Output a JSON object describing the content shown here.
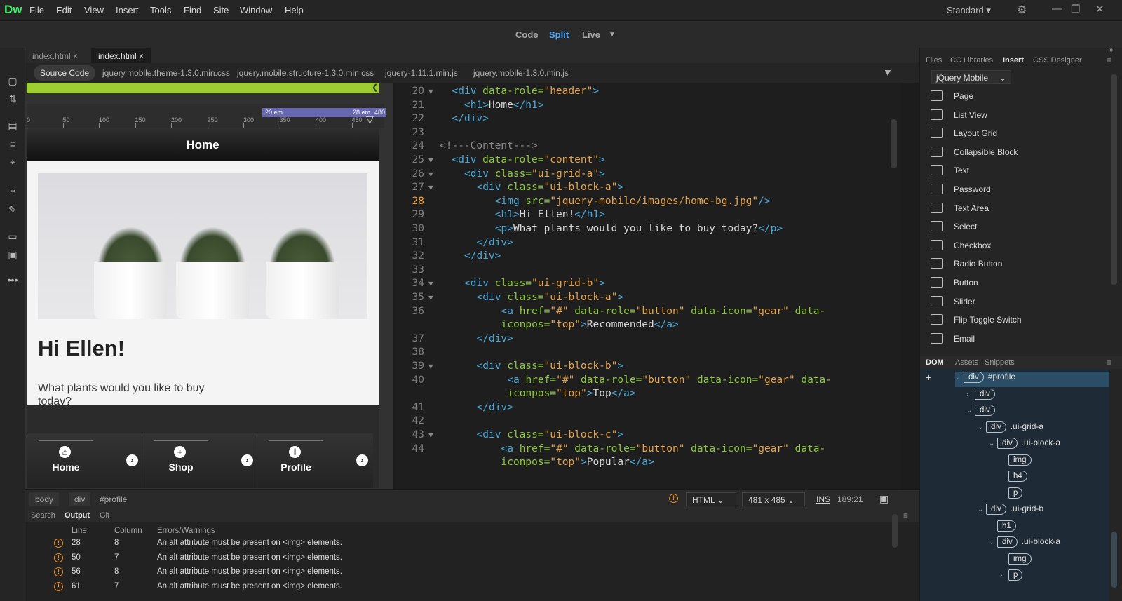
{
  "app": {
    "logo": "Dw",
    "workspace": "Standard ▾"
  },
  "menu": [
    "File",
    "Edit",
    "View",
    "Insert",
    "Tools",
    "Find",
    "Site",
    "Window",
    "Help"
  ],
  "view_modes": {
    "code": "Code",
    "split": "Split",
    "live": "Live",
    "active": "Split"
  },
  "doc_tabs": [
    {
      "label": "index.html ×",
      "active": false
    },
    {
      "label": "index.html ×",
      "active": true
    }
  ],
  "related_files": {
    "source": "Source Code",
    "files": [
      "jquery.mobile.theme-1.3.0.min.css",
      "jquery.mobile.structure-1.3.0.min.css",
      "jquery-1.11.1.min.js",
      "jquery.mobile-1.3.0.min.js"
    ]
  },
  "ruler": {
    "ticks": [
      "0",
      "50",
      "100",
      "150",
      "200",
      "250",
      "300",
      "350",
      "400",
      "450"
    ],
    "bp1": "20 em",
    "bp2": "28 em",
    "bp3": "480"
  },
  "preview": {
    "header": "Home",
    "heading": "Hi Ellen!",
    "text": "What plants would you like to buy today?",
    "nav": [
      {
        "icon": "home-icon",
        "label": "Home"
      },
      {
        "icon": "plus-icon",
        "label": "Shop"
      },
      {
        "icon": "info-icon",
        "label": "Profile"
      }
    ]
  },
  "code": {
    "current_line": "28",
    "lines": [
      {
        "n": "20",
        "fold": true,
        "i": 1,
        "t": [
          [
            "tg",
            "<div "
          ],
          [
            "at",
            "data-role="
          ],
          [
            "va",
            "\"header\""
          ],
          [
            "tg",
            ">"
          ]
        ]
      },
      {
        "n": "21",
        "fold": false,
        "i": 2,
        "t": [
          [
            "tg",
            "<h1>"
          ],
          [
            "tx",
            "Home"
          ],
          [
            "tg",
            "</h1>"
          ]
        ]
      },
      {
        "n": "22",
        "fold": false,
        "i": 1,
        "t": [
          [
            "tg",
            "</div>"
          ]
        ]
      },
      {
        "n": "23",
        "fold": false,
        "i": 0,
        "t": []
      },
      {
        "n": "24",
        "fold": false,
        "i": 0,
        "t": [
          [
            "cm",
            "<!---Content--->"
          ]
        ]
      },
      {
        "n": "25",
        "fold": true,
        "i": 1,
        "t": [
          [
            "tg",
            "<div "
          ],
          [
            "at",
            "data-role="
          ],
          [
            "va",
            "\"content\""
          ],
          [
            "tg",
            ">"
          ]
        ]
      },
      {
        "n": "26",
        "fold": true,
        "i": 2,
        "t": [
          [
            "tg",
            "<div "
          ],
          [
            "at",
            "class="
          ],
          [
            "va",
            "\"ui-grid-a\""
          ],
          [
            "tg",
            ">"
          ]
        ]
      },
      {
        "n": "27",
        "fold": true,
        "i": 3,
        "t": [
          [
            "tg",
            "<div "
          ],
          [
            "at",
            "class="
          ],
          [
            "va",
            "\"ui-block-a\""
          ],
          [
            "tg",
            ">"
          ]
        ]
      },
      {
        "n": "28",
        "fold": false,
        "i": 4.5,
        "t": [
          [
            "tg",
            "<img "
          ],
          [
            "at",
            "src="
          ],
          [
            "va",
            "\"jquery-mobile/images/home-bg.jpg\""
          ],
          [
            "tg",
            "/>"
          ]
        ]
      },
      {
        "n": "29",
        "fold": false,
        "i": 4.5,
        "t": [
          [
            "tg",
            "<h1>"
          ],
          [
            "tx",
            "Hi Ellen!"
          ],
          [
            "tg",
            "</h1>"
          ]
        ]
      },
      {
        "n": "30",
        "fold": false,
        "i": 4.5,
        "t": [
          [
            "tg",
            "<p>"
          ],
          [
            "tx",
            "What plants would you like to buy today?"
          ],
          [
            "tg",
            "</p>"
          ]
        ]
      },
      {
        "n": "31",
        "fold": false,
        "i": 3,
        "t": [
          [
            "tg",
            "</div>"
          ]
        ]
      },
      {
        "n": "32",
        "fold": false,
        "i": 2,
        "t": [
          [
            "tg",
            "</div>"
          ]
        ]
      },
      {
        "n": "33",
        "fold": false,
        "i": 0,
        "t": []
      },
      {
        "n": "34",
        "fold": true,
        "i": 2,
        "t": [
          [
            "tg",
            "<div "
          ],
          [
            "at",
            "class="
          ],
          [
            "va",
            "\"ui-grid-b\""
          ],
          [
            "tg",
            ">"
          ]
        ]
      },
      {
        "n": "35",
        "fold": true,
        "i": 3,
        "t": [
          [
            "tg",
            "<div "
          ],
          [
            "at",
            "class="
          ],
          [
            "va",
            "\"ui-block-a\""
          ],
          [
            "tg",
            ">"
          ]
        ]
      },
      {
        "n": "36",
        "fold": false,
        "i": 5,
        "t": [
          [
            "tg",
            "<a "
          ],
          [
            "at",
            "href="
          ],
          [
            "va",
            "\"#\" "
          ],
          [
            "at",
            "data-role="
          ],
          [
            "va",
            "\"button\" "
          ],
          [
            "at",
            "data-icon="
          ],
          [
            "va",
            "\"gear\" "
          ],
          [
            "at",
            "data-"
          ]
        ]
      },
      {
        "n": "",
        "fold": false,
        "i": 5,
        "t": [
          [
            "at",
            "iconpos="
          ],
          [
            "va",
            "\"top\""
          ],
          [
            "tg",
            ">"
          ],
          [
            "tx",
            "Recommended"
          ],
          [
            "tg",
            "</a>"
          ]
        ]
      },
      {
        "n": "37",
        "fold": false,
        "i": 3,
        "t": [
          [
            "tg",
            "</div>"
          ]
        ]
      },
      {
        "n": "38",
        "fold": false,
        "i": 0,
        "t": []
      },
      {
        "n": "39",
        "fold": true,
        "i": 3,
        "t": [
          [
            "tg",
            "<div "
          ],
          [
            "at",
            "class="
          ],
          [
            "va",
            "\"ui-block-b\""
          ],
          [
            "tg",
            ">"
          ]
        ]
      },
      {
        "n": "40",
        "fold": false,
        "i": 5.5,
        "t": [
          [
            "tg",
            "<a "
          ],
          [
            "at",
            "href="
          ],
          [
            "va",
            "\"#\" "
          ],
          [
            "at",
            "data-role="
          ],
          [
            "va",
            "\"button\" "
          ],
          [
            "at",
            "data-icon="
          ],
          [
            "va",
            "\"gear\" "
          ],
          [
            "at",
            "data-"
          ]
        ]
      },
      {
        "n": "",
        "fold": false,
        "i": 5.5,
        "t": [
          [
            "at",
            "iconpos="
          ],
          [
            "va",
            "\"top\""
          ],
          [
            "tg",
            ">"
          ],
          [
            "tx",
            "Top"
          ],
          [
            "tg",
            "</a>"
          ]
        ]
      },
      {
        "n": "41",
        "fold": false,
        "i": 3,
        "t": [
          [
            "tg",
            "</div>"
          ]
        ]
      },
      {
        "n": "42",
        "fold": false,
        "i": 0,
        "t": []
      },
      {
        "n": "43",
        "fold": true,
        "i": 3,
        "t": [
          [
            "tg",
            "<div "
          ],
          [
            "at",
            "class="
          ],
          [
            "va",
            "\"ui-block-c\""
          ],
          [
            "tg",
            ">"
          ]
        ]
      },
      {
        "n": "44",
        "fold": false,
        "i": 5,
        "t": [
          [
            "tg",
            "<a "
          ],
          [
            "at",
            "href="
          ],
          [
            "va",
            "\"#\" "
          ],
          [
            "at",
            "data-role="
          ],
          [
            "va",
            "\"button\" "
          ],
          [
            "at",
            "data-icon="
          ],
          [
            "va",
            "\"gear\" "
          ],
          [
            "at",
            "data-"
          ]
        ]
      },
      {
        "n": "",
        "fold": false,
        "i": 5,
        "t": [
          [
            "at",
            "iconpos="
          ],
          [
            "va",
            "\"top\""
          ],
          [
            "tg",
            ">"
          ],
          [
            "tx",
            "Popular"
          ],
          [
            "tg",
            "</a>"
          ]
        ]
      }
    ]
  },
  "status": {
    "crumbs": [
      "body",
      "div",
      "#profile"
    ],
    "lang": "HTML",
    "size": "481 x 485",
    "mode": "INS",
    "pos": "189:21"
  },
  "output": {
    "tabs": [
      "Search",
      "Output",
      "Git"
    ],
    "headers": {
      "line": "Line",
      "col": "Column",
      "err": "Errors/Warnings"
    },
    "rows": [
      {
        "line": "28",
        "col": "8",
        "msg": "An alt attribute must be present on <img> elements."
      },
      {
        "line": "50",
        "col": "7",
        "msg": "An alt attribute must be present on <img> elements."
      },
      {
        "line": "56",
        "col": "8",
        "msg": "An alt attribute must be present on <img> elements."
      },
      {
        "line": "61",
        "col": "7",
        "msg": "An alt attribute must be present on <img> elements."
      }
    ]
  },
  "panel_tabs": [
    "Files",
    "CC Libraries",
    "Insert",
    "CSS Designer"
  ],
  "insert": {
    "category": "jQuery Mobile",
    "items": [
      "Page",
      "List View",
      "Layout Grid",
      "Collapsible Block",
      "Text",
      "Password",
      "Text Area",
      "Select",
      "Checkbox",
      "Radio Button",
      "Button",
      "Slider",
      "Flip Toggle Switch",
      "Email"
    ]
  },
  "dom_tabs": [
    "DOM",
    "Assets",
    "Snippets"
  ],
  "dom": [
    {
      "tag": "div",
      "sel": "#profile",
      "open": true,
      "lvl": 2
    },
    {
      "tag": "div",
      "sel": "",
      "open": false,
      "lvl": 3
    },
    {
      "tag": "div",
      "sel": "",
      "open": true,
      "lvl": 3
    },
    {
      "tag": "div",
      "sel": ".ui-grid-a",
      "open": true,
      "lvl": 4
    },
    {
      "tag": "div",
      "sel": ".ui-block-a",
      "open": true,
      "lvl": 5
    },
    {
      "tag": "img",
      "sel": "",
      "open": null,
      "lvl": 6
    },
    {
      "tag": "h4",
      "sel": "",
      "open": null,
      "lvl": 6
    },
    {
      "tag": "p",
      "sel": "",
      "open": null,
      "lvl": 6
    },
    {
      "tag": "div",
      "sel": ".ui-grid-b",
      "open": true,
      "lvl": 4
    },
    {
      "tag": "h1",
      "sel": "",
      "open": null,
      "lvl": 5
    },
    {
      "tag": "div",
      "sel": ".ui-block-a",
      "open": true,
      "lvl": 5
    },
    {
      "tag": "img",
      "sel": "",
      "open": null,
      "lvl": 6
    },
    {
      "tag": "p",
      "sel": "",
      "open": false,
      "lvl": 6
    }
  ]
}
